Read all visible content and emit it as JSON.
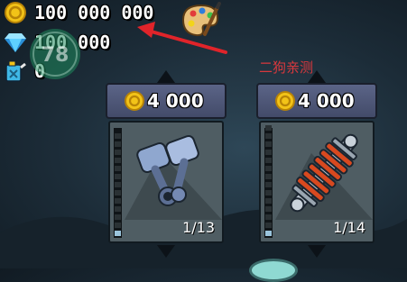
{
  "hud": {
    "coins": "100 000 000",
    "gems": "100 000",
    "fuel": "0"
  },
  "annotation": {
    "note": "二狗亲测"
  },
  "watermark": {
    "glyph": "78"
  },
  "cards": [
    {
      "price": "4 000",
      "level": "1/13",
      "level_current": 1,
      "level_max": 13,
      "part": "engine-pistons-icon"
    },
    {
      "price": "4 000",
      "level": "1/14",
      "level_current": 1,
      "level_max": 14,
      "part": "suspension-spring-icon"
    }
  ],
  "colors": {
    "coin": "#f2c318",
    "gem": "#3bb8ff",
    "arrow": "#e0242a",
    "price_bar": "#4d5678",
    "card_body": "#4f5d63"
  }
}
